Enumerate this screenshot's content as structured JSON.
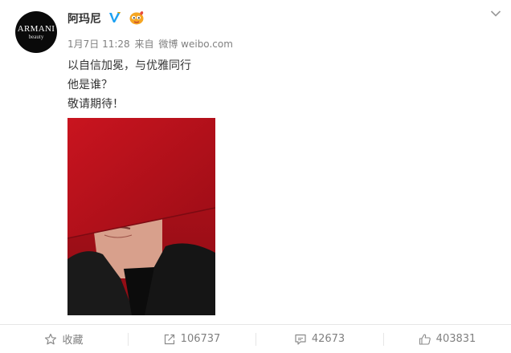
{
  "account": {
    "avatar_text": "ARMANI",
    "avatar_subtext": "beauty",
    "name": "阿玛尼",
    "verified_icon": "verified-v-badge-icon",
    "badge_icon": "emoji-badge-icon"
  },
  "post": {
    "date": "1月7日 11:28",
    "source_prefix": "来自",
    "source": "微博 weibo.com",
    "lines": [
      "以自信加冕，与优雅同行",
      "他是谁？",
      "敬请期待！"
    ],
    "image_icon": "portrait-photo"
  },
  "menu": {
    "icon": "chevron-down-icon"
  },
  "actions": {
    "favorite": {
      "label": "收藏",
      "icon": "star-icon"
    },
    "repost": {
      "count": "106737",
      "icon": "share-icon"
    },
    "comment": {
      "count": "42673",
      "icon": "comment-icon"
    },
    "like": {
      "count": "403831",
      "icon": "thumbs-up-icon"
    }
  },
  "colors": {
    "text": "#333333",
    "muted": "#808080",
    "verified": "#1da1f2",
    "photo_red": "#b8121c"
  }
}
